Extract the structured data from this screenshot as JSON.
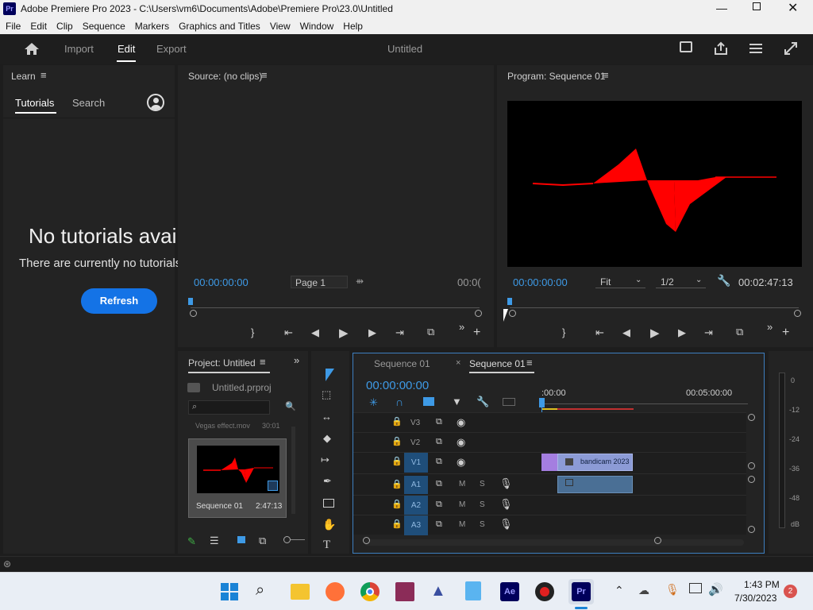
{
  "window": {
    "title": "Adobe Premiere Pro 2023 - C:\\Users\\vm6\\Documents\\Adobe\\Premiere Pro\\23.0\\Untitled",
    "app_icon": "Pr"
  },
  "menu": [
    "File",
    "Edit",
    "Clip",
    "Sequence",
    "Markers",
    "Graphics and Titles",
    "View",
    "Window",
    "Help"
  ],
  "workspace": {
    "tabs": [
      "Import",
      "Edit",
      "Export"
    ],
    "active": "Edit",
    "project_title": "Untitled"
  },
  "learn": {
    "header": "Learn",
    "tabs": [
      "Tutorials",
      "Search"
    ],
    "heading": "No tutorials avail",
    "message": "There are currently no tutorials",
    "refresh_label": "Refresh"
  },
  "source": {
    "header": "Source: (no clips)",
    "timecode": "00:00:00:00",
    "page": "Page 1",
    "end_timecode": "00:0("
  },
  "program": {
    "header": "Program: Sequence 01",
    "timecode": "00:00:00:00",
    "fit": "Fit",
    "resolution": "1/2",
    "duration": "00:02:47:13"
  },
  "project": {
    "header": "Project: Untitled",
    "file": "Untitled.prproj",
    "clip_top_name": "Vegas effect.mov",
    "clip_top_dur": "30:01",
    "clip_name": "Sequence 01",
    "clip_dur": "2:47:13"
  },
  "timeline": {
    "tabs": [
      "Sequence 01",
      "Sequence 01"
    ],
    "timecode": "00:00:00:00",
    "ruler": [
      ":00:00",
      "00:05:00:00"
    ],
    "tracks": [
      {
        "id": "V3",
        "kind": "video"
      },
      {
        "id": "V2",
        "kind": "video"
      },
      {
        "id": "V1",
        "kind": "video"
      },
      {
        "id": "A1",
        "kind": "audio"
      },
      {
        "id": "A2",
        "kind": "audio"
      },
      {
        "id": "A3",
        "kind": "audio"
      }
    ],
    "audio_labels": {
      "m": "M",
      "s": "S"
    },
    "clip_label": "bandicam 2023"
  },
  "meter": {
    "labels": [
      "0",
      "-12",
      "-24",
      "-36",
      "-48",
      "dB"
    ]
  },
  "taskbar": {
    "time": "1:43 PM",
    "date": "7/30/2023",
    "badge": "2"
  },
  "colors": {
    "accent": "#1473e6",
    "timecode": "#3e9ae6",
    "track_id": "#1f4e7a",
    "clip_video": "#8c9bd6",
    "clip_audio": "#4a6f95",
    "playhead": "#3e9ae6"
  }
}
